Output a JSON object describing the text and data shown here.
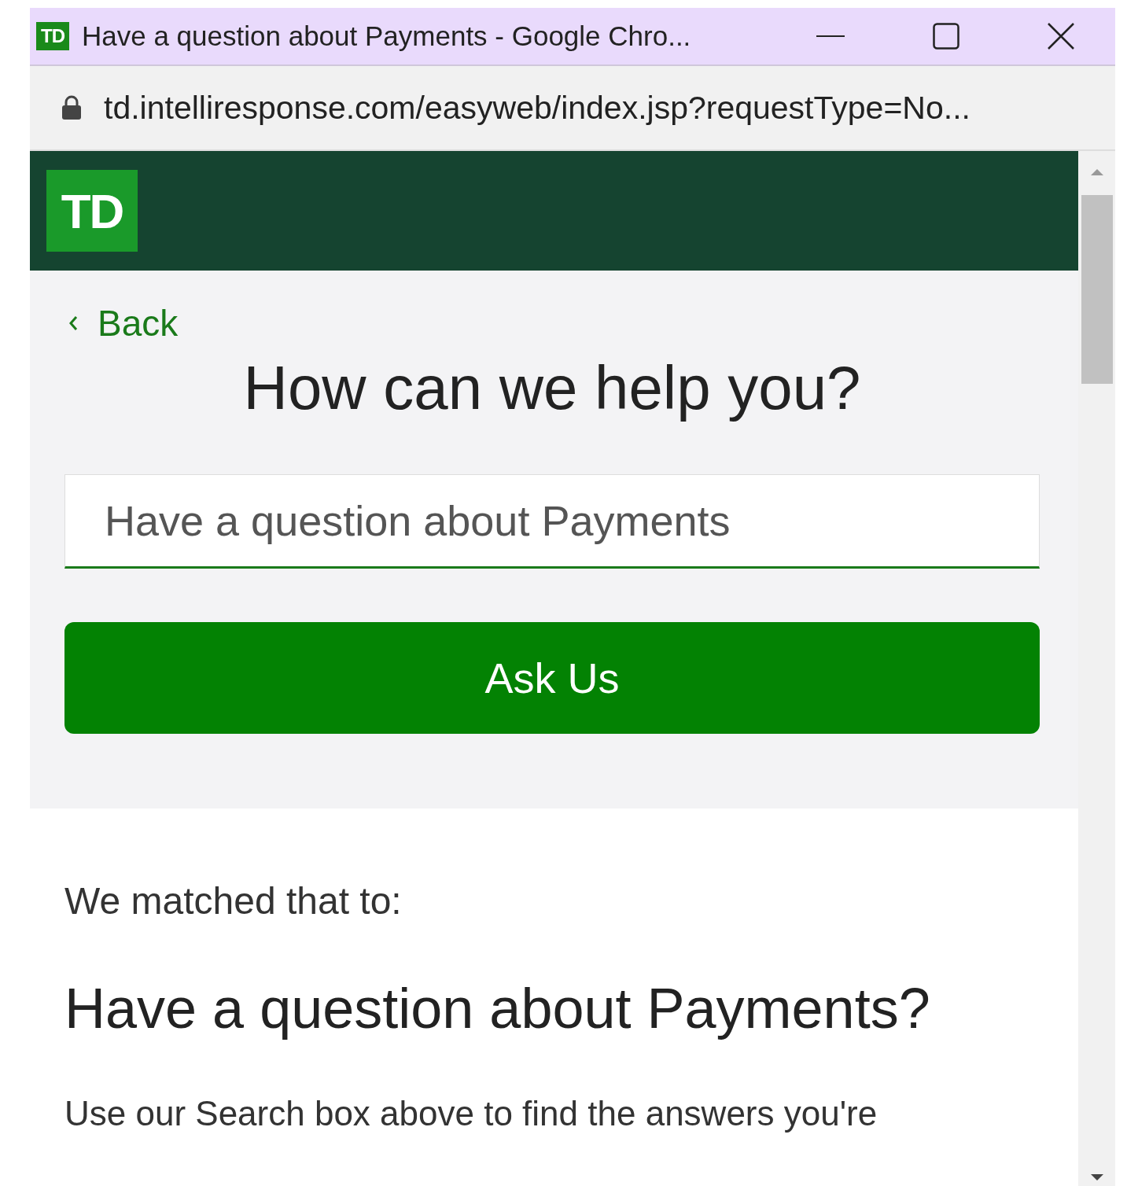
{
  "window": {
    "title": "Have a question about Payments - Google Chro...",
    "favicon": "TD"
  },
  "address_bar": {
    "url": "td.intelliresponse.com/easyweb/index.jsp?requestType=No..."
  },
  "header": {
    "logo": "TD"
  },
  "back_link": {
    "label": "Back"
  },
  "heading": "How can we help you?",
  "search": {
    "value": "Have a question about Payments"
  },
  "ask_button": {
    "label": "Ask Us"
  },
  "result": {
    "intro": "We matched that to:",
    "title": "Have a question about Payments?",
    "body": "Use our Search box above to find the answers you're"
  }
}
